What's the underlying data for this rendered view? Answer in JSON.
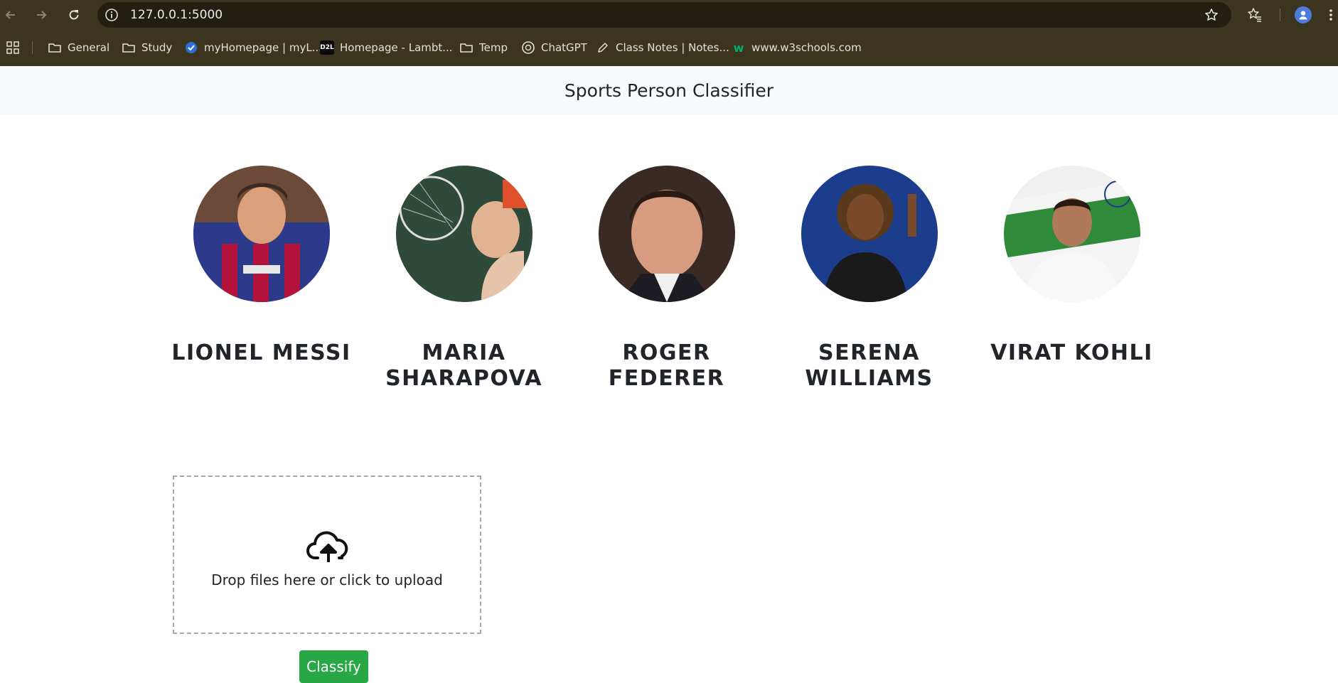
{
  "browser": {
    "url": "127.0.0.1:5000",
    "bookmarks": [
      {
        "label": "General",
        "icon": "folder-icon"
      },
      {
        "label": "Study",
        "icon": "folder-icon"
      },
      {
        "label": "myHomepage | myL...",
        "icon": "site-favicon-icon"
      },
      {
        "label": "Homepage - Lambt...",
        "icon": "d2l-favicon-icon",
        "badge": "D2L"
      },
      {
        "label": "Temp",
        "icon": "folder-icon"
      },
      {
        "label": "ChatGPT",
        "icon": "chatgpt-icon"
      },
      {
        "label": "Class Notes | Notes...",
        "icon": "pencil-icon"
      },
      {
        "label": "www.w3schools.com",
        "icon": "w3schools-icon",
        "badge": "w"
      }
    ]
  },
  "page": {
    "title": "Sports Person Classifier",
    "players": [
      {
        "name": "LIONEL MESSI"
      },
      {
        "name": "MARIA SHARAPOVA"
      },
      {
        "name": "ROGER FEDERER"
      },
      {
        "name": "SERENA WILLIAMS"
      },
      {
        "name": "VIRAT KOHLI"
      }
    ],
    "dropzone": {
      "text": "Drop files here or click to upload",
      "icon": "cloud-upload-icon"
    },
    "classify_label": "Classify"
  },
  "colors": {
    "chrome_bg": "#3b3520",
    "url_bg": "#221e10",
    "header_bg": "#f8f9fa",
    "button_green": "#28a745"
  }
}
